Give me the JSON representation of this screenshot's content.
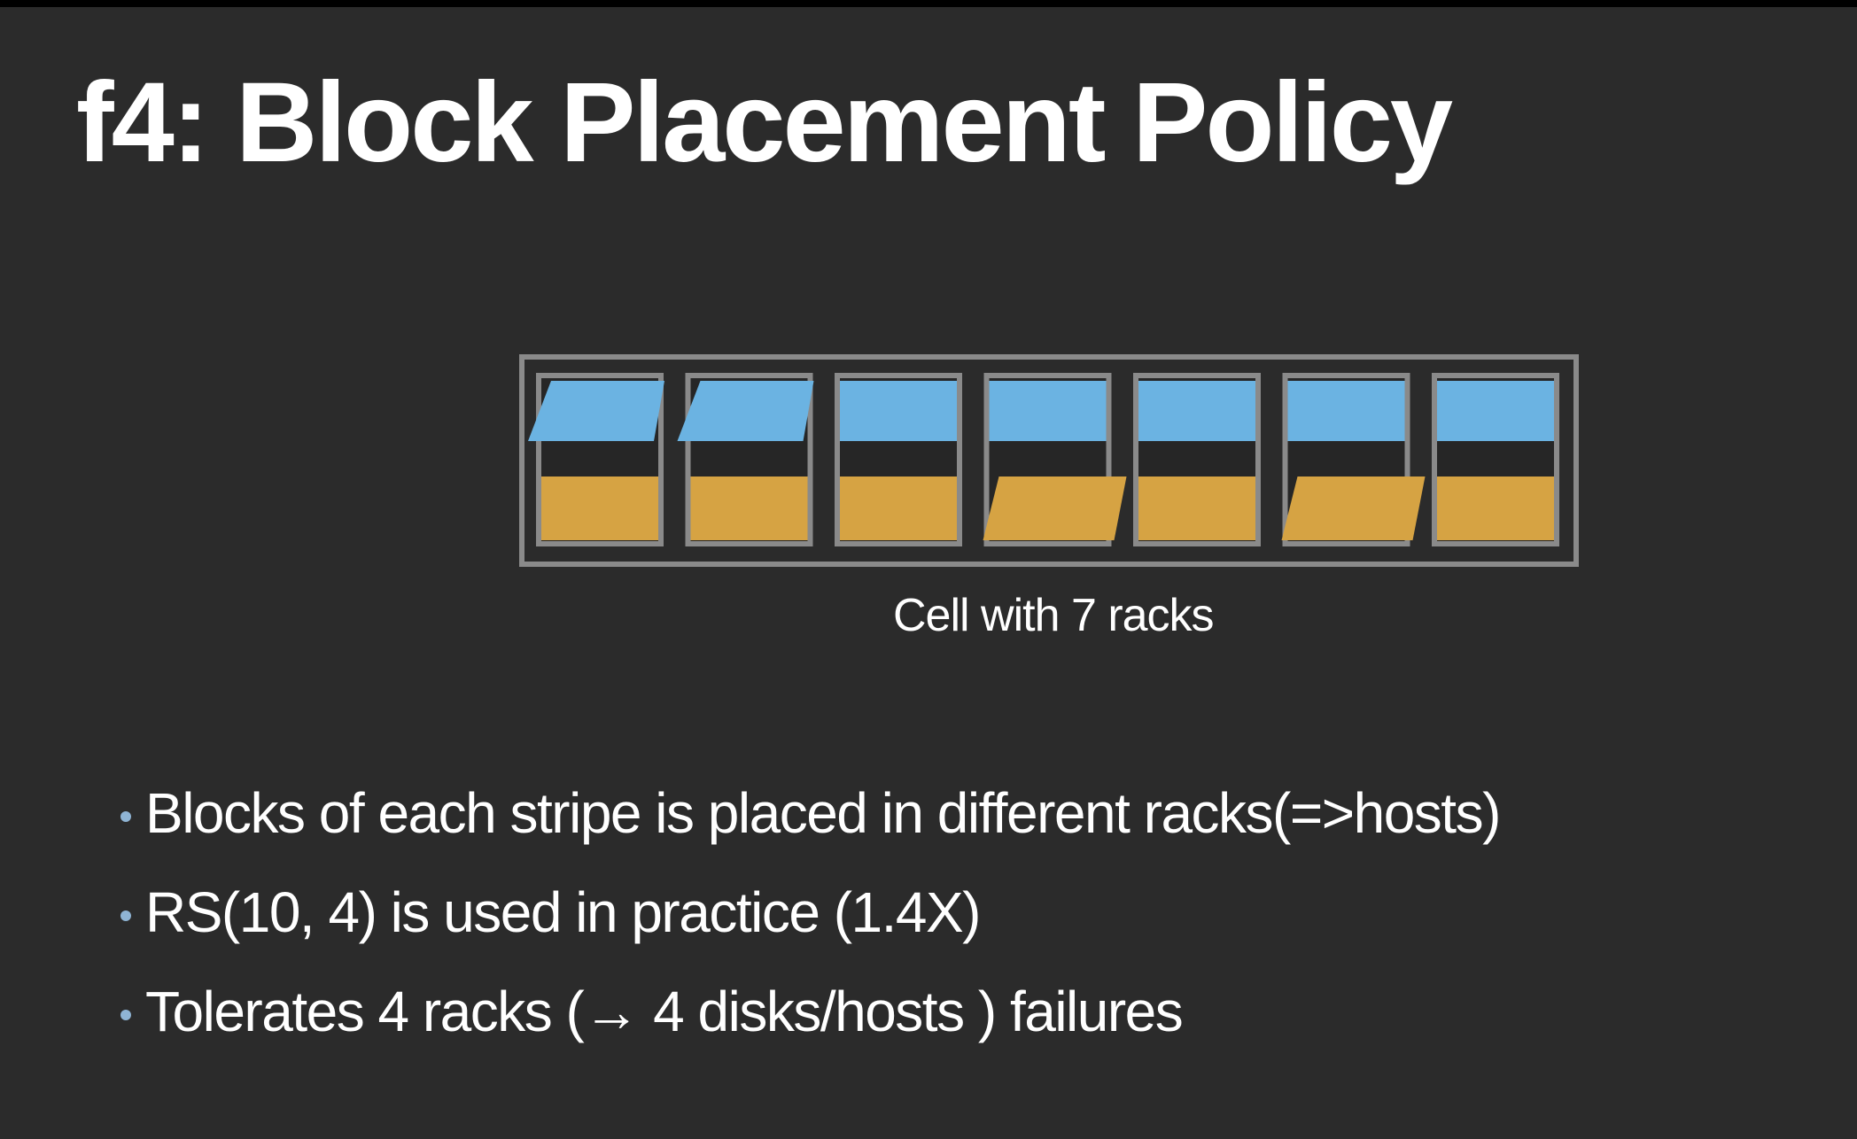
{
  "slide": {
    "title": "f4: Block Placement Policy"
  },
  "diagram": {
    "caption": "Cell with 7 racks",
    "colors": {
      "data_block": "#6bb3e2",
      "parity_block": "#d6a343",
      "frame": "#8a8a8a",
      "rack_interior": "#262626"
    },
    "racks": [
      {
        "top_block": "data",
        "top_slanted": true,
        "bottom_block": "parity",
        "bottom_slanted": false
      },
      {
        "top_block": "data",
        "top_slanted": true,
        "bottom_block": "parity",
        "bottom_slanted": false
      },
      {
        "top_block": "data",
        "top_slanted": false,
        "bottom_block": "parity",
        "bottom_slanted": false
      },
      {
        "top_block": "data",
        "top_slanted": false,
        "bottom_block": "parity",
        "bottom_slanted": true
      },
      {
        "top_block": "data",
        "top_slanted": false,
        "bottom_block": "parity",
        "bottom_slanted": false
      },
      {
        "top_block": "data",
        "top_slanted": false,
        "bottom_block": "parity",
        "bottom_slanted": true
      },
      {
        "top_block": "data",
        "top_slanted": false,
        "bottom_block": "parity",
        "bottom_slanted": false
      }
    ]
  },
  "bullets": [
    "Blocks of each stripe is placed in different racks(=>hosts)",
    "RS(10, 4) is used in practice (1.4X)",
    "Tolerates 4 racks (→ 4 disks/hosts ) failures"
  ]
}
